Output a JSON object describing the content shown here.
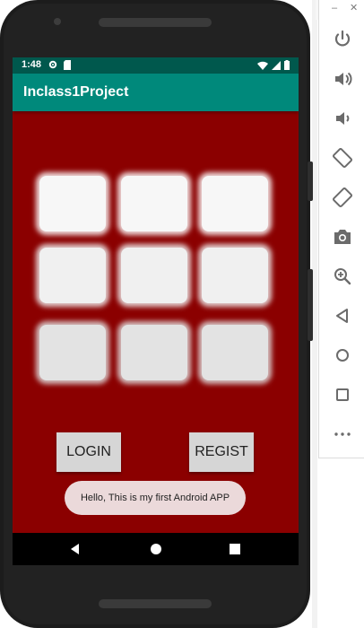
{
  "status_bar": {
    "time": "1:48",
    "left_icons": [
      "settings-icon",
      "sd-card-icon"
    ],
    "right_icons": [
      "wifi-icon",
      "signal-icon",
      "battery-icon"
    ]
  },
  "app_bar": {
    "title": "Inclass1Project"
  },
  "grid": {
    "rows": 3,
    "cols": 3
  },
  "buttons": {
    "login": "LOGIN",
    "regist": "REGIST"
  },
  "toast": {
    "message": "Hello, This is my first Android APP"
  },
  "nav_bar": {
    "icons": [
      "back-icon",
      "home-icon",
      "recents-icon"
    ]
  },
  "emulator_toolbar": {
    "window_controls": [
      "minimize",
      "close"
    ],
    "items": [
      "power",
      "volume-up",
      "volume-down",
      "rotate-left",
      "rotate-right",
      "screenshot",
      "zoom",
      "back",
      "home",
      "overview",
      "more"
    ]
  },
  "colors": {
    "status_bar": "#00584d",
    "app_bar": "#00897b",
    "background": "#8b0000",
    "button": "#d6d6d6",
    "toast": "#ebd9da"
  }
}
